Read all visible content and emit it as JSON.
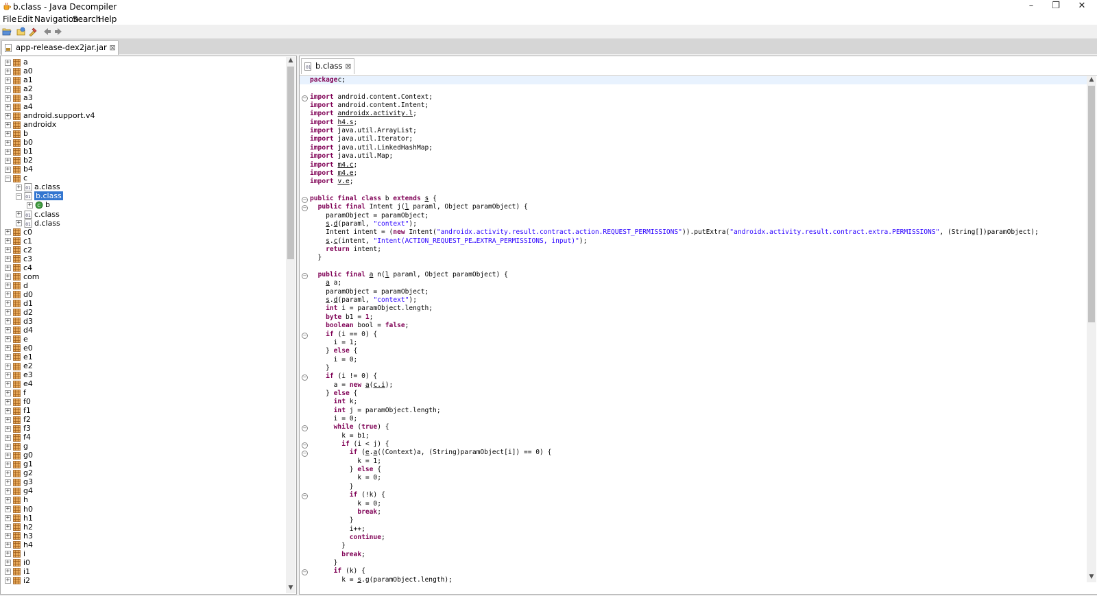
{
  "window": {
    "title": "b.class - Java Decompiler",
    "controls": [
      "–",
      "❐",
      "✕"
    ]
  },
  "menu": [
    "File",
    "Edit",
    "Navigation",
    "Search",
    "Help"
  ],
  "left_tab": {
    "label": "app-release-dex2jar.jar"
  },
  "tree": [
    {
      "label": "a",
      "level": 0,
      "type": "pkg",
      "toggle": "+"
    },
    {
      "label": "a0",
      "level": 0,
      "type": "pkg",
      "toggle": "+"
    },
    {
      "label": "a1",
      "level": 0,
      "type": "pkg",
      "toggle": "+"
    },
    {
      "label": "a2",
      "level": 0,
      "type": "pkg",
      "toggle": "+"
    },
    {
      "label": "a3",
      "level": 0,
      "type": "pkg",
      "toggle": "+"
    },
    {
      "label": "a4",
      "level": 0,
      "type": "pkg",
      "toggle": "+"
    },
    {
      "label": "android.support.v4",
      "level": 0,
      "type": "pkg",
      "toggle": "+"
    },
    {
      "label": "androidx",
      "level": 0,
      "type": "pkg",
      "toggle": "+"
    },
    {
      "label": "b",
      "level": 0,
      "type": "pkg",
      "toggle": "+"
    },
    {
      "label": "b0",
      "level": 0,
      "type": "pkg",
      "toggle": "+"
    },
    {
      "label": "b1",
      "level": 0,
      "type": "pkg",
      "toggle": "+"
    },
    {
      "label": "b2",
      "level": 0,
      "type": "pkg",
      "toggle": "+"
    },
    {
      "label": "b4",
      "level": 0,
      "type": "pkg",
      "toggle": "+"
    },
    {
      "label": "c",
      "level": 0,
      "type": "pkg",
      "toggle": "-"
    },
    {
      "label": "a.class",
      "level": 1,
      "type": "class",
      "toggle": "+"
    },
    {
      "label": "b.class",
      "level": 1,
      "type": "class",
      "toggle": "-",
      "selected": true
    },
    {
      "label": "b",
      "level": 2,
      "type": "inner",
      "toggle": "+"
    },
    {
      "label": "c.class",
      "level": 1,
      "type": "class",
      "toggle": "+"
    },
    {
      "label": "d.class",
      "level": 1,
      "type": "class",
      "toggle": "+"
    },
    {
      "label": "c0",
      "level": 0,
      "type": "pkg",
      "toggle": "+"
    },
    {
      "label": "c1",
      "level": 0,
      "type": "pkg",
      "toggle": "+"
    },
    {
      "label": "c2",
      "level": 0,
      "type": "pkg",
      "toggle": "+"
    },
    {
      "label": "c3",
      "level": 0,
      "type": "pkg",
      "toggle": "+"
    },
    {
      "label": "c4",
      "level": 0,
      "type": "pkg",
      "toggle": "+"
    },
    {
      "label": "com",
      "level": 0,
      "type": "pkg",
      "toggle": "+"
    },
    {
      "label": "d",
      "level": 0,
      "type": "pkg",
      "toggle": "+"
    },
    {
      "label": "d0",
      "level": 0,
      "type": "pkg",
      "toggle": "+"
    },
    {
      "label": "d1",
      "level": 0,
      "type": "pkg",
      "toggle": "+"
    },
    {
      "label": "d2",
      "level": 0,
      "type": "pkg",
      "toggle": "+"
    },
    {
      "label": "d3",
      "level": 0,
      "type": "pkg",
      "toggle": "+"
    },
    {
      "label": "d4",
      "level": 0,
      "type": "pkg",
      "toggle": "+"
    },
    {
      "label": "e",
      "level": 0,
      "type": "pkg",
      "toggle": "+"
    },
    {
      "label": "e0",
      "level": 0,
      "type": "pkg",
      "toggle": "+"
    },
    {
      "label": "e1",
      "level": 0,
      "type": "pkg",
      "toggle": "+"
    },
    {
      "label": "e2",
      "level": 0,
      "type": "pkg",
      "toggle": "+"
    },
    {
      "label": "e3",
      "level": 0,
      "type": "pkg",
      "toggle": "+"
    },
    {
      "label": "e4",
      "level": 0,
      "type": "pkg",
      "toggle": "+"
    },
    {
      "label": "f",
      "level": 0,
      "type": "pkg",
      "toggle": "+"
    },
    {
      "label": "f0",
      "level": 0,
      "type": "pkg",
      "toggle": "+"
    },
    {
      "label": "f1",
      "level": 0,
      "type": "pkg",
      "toggle": "+"
    },
    {
      "label": "f2",
      "level": 0,
      "type": "pkg",
      "toggle": "+"
    },
    {
      "label": "f3",
      "level": 0,
      "type": "pkg",
      "toggle": "+"
    },
    {
      "label": "f4",
      "level": 0,
      "type": "pkg",
      "toggle": "+"
    },
    {
      "label": "g",
      "level": 0,
      "type": "pkg",
      "toggle": "+"
    },
    {
      "label": "g0",
      "level": 0,
      "type": "pkg",
      "toggle": "+"
    },
    {
      "label": "g1",
      "level": 0,
      "type": "pkg",
      "toggle": "+"
    },
    {
      "label": "g2",
      "level": 0,
      "type": "pkg",
      "toggle": "+"
    },
    {
      "label": "g3",
      "level": 0,
      "type": "pkg",
      "toggle": "+"
    },
    {
      "label": "g4",
      "level": 0,
      "type": "pkg",
      "toggle": "+"
    },
    {
      "label": "h",
      "level": 0,
      "type": "pkg",
      "toggle": "+"
    },
    {
      "label": "h0",
      "level": 0,
      "type": "pkg",
      "toggle": "+"
    },
    {
      "label": "h1",
      "level": 0,
      "type": "pkg",
      "toggle": "+"
    },
    {
      "label": "h2",
      "level": 0,
      "type": "pkg",
      "toggle": "+"
    },
    {
      "label": "h3",
      "level": 0,
      "type": "pkg",
      "toggle": "+"
    },
    {
      "label": "h4",
      "level": 0,
      "type": "pkg",
      "toggle": "+"
    },
    {
      "label": "i",
      "level": 0,
      "type": "pkg",
      "toggle": "+"
    },
    {
      "label": "i0",
      "level": 0,
      "type": "pkg",
      "toggle": "+"
    },
    {
      "label": "i1",
      "level": 0,
      "type": "pkg",
      "toggle": "+"
    },
    {
      "label": "i2",
      "level": 0,
      "type": "pkg",
      "toggle": "+"
    }
  ],
  "code_tab": {
    "label": "b.class"
  },
  "code": [
    {
      "fold": false,
      "t": [
        [
          "k",
          "package"
        ],
        [
          "",
          "c;"
        ]
      ]
    },
    {
      "fold": false,
      "t": []
    },
    {
      "fold": true,
      "t": [
        [
          "k",
          "import"
        ],
        [
          "",
          " android.content.Context;"
        ]
      ]
    },
    {
      "fold": false,
      "t": [
        [
          "k",
          "import"
        ],
        [
          "",
          " android.content.Intent;"
        ]
      ]
    },
    {
      "fold": false,
      "t": [
        [
          "k",
          "import"
        ],
        [
          "",
          " "
        ],
        [
          "u",
          "androidx.activity.l"
        ],
        [
          "",
          ";"
        ]
      ]
    },
    {
      "fold": false,
      "t": [
        [
          "k",
          "import"
        ],
        [
          "",
          " "
        ],
        [
          "u",
          "h4.s"
        ],
        [
          "",
          ";"
        ]
      ]
    },
    {
      "fold": false,
      "t": [
        [
          "k",
          "import"
        ],
        [
          "",
          " java.util.ArrayList;"
        ]
      ]
    },
    {
      "fold": false,
      "t": [
        [
          "k",
          "import"
        ],
        [
          "",
          " java.util.Iterator;"
        ]
      ]
    },
    {
      "fold": false,
      "t": [
        [
          "k",
          "import"
        ],
        [
          "",
          " java.util.LinkedHashMap;"
        ]
      ]
    },
    {
      "fold": false,
      "t": [
        [
          "k",
          "import"
        ],
        [
          "",
          " java.util.Map;"
        ]
      ]
    },
    {
      "fold": false,
      "t": [
        [
          "k",
          "import"
        ],
        [
          "",
          " "
        ],
        [
          "u",
          "m4.c"
        ],
        [
          "",
          ";"
        ]
      ]
    },
    {
      "fold": false,
      "t": [
        [
          "k",
          "import"
        ],
        [
          "",
          " "
        ],
        [
          "u",
          "m4.e"
        ],
        [
          "",
          ";"
        ]
      ]
    },
    {
      "fold": false,
      "t": [
        [
          "k",
          "import"
        ],
        [
          "",
          " "
        ],
        [
          "u",
          "v.e"
        ],
        [
          "",
          ";"
        ]
      ]
    },
    {
      "fold": false,
      "t": []
    },
    {
      "fold": true,
      "t": [
        [
          "k",
          "public final class"
        ],
        [
          "",
          " b "
        ],
        [
          "k",
          "extends"
        ],
        [
          "",
          " "
        ],
        [
          "u",
          "s"
        ],
        [
          "",
          " {"
        ]
      ]
    },
    {
      "fold": true,
      "t": [
        [
          "",
          "  "
        ],
        [
          "k",
          "public final"
        ],
        [
          "",
          " Intent j("
        ],
        [
          "u",
          "l"
        ],
        [
          "",
          " paraml, Object paramObject) {"
        ]
      ]
    },
    {
      "fold": false,
      "t": [
        [
          "",
          "    paramObject = paramObject;"
        ]
      ]
    },
    {
      "fold": false,
      "t": [
        [
          "",
          "    "
        ],
        [
          "u",
          "s"
        ],
        [
          "",
          "."
        ],
        [
          "u",
          "d"
        ],
        [
          "",
          "(paraml, "
        ],
        [
          "s",
          "\"context\""
        ],
        [
          "",
          ");"
        ]
      ]
    },
    {
      "fold": false,
      "t": [
        [
          "",
          "    Intent intent = ("
        ],
        [
          "k",
          "new"
        ],
        [
          "",
          " Intent("
        ],
        [
          "s",
          "\"androidx.activity.result.contract.action.REQUEST_PERMISSIONS\""
        ],
        [
          "",
          ")).putExtra("
        ],
        [
          "s",
          "\"androidx.activity.result.contract.extra.PERMISSIONS\""
        ],
        [
          "",
          ", (String[])paramObject);"
        ]
      ]
    },
    {
      "fold": false,
      "t": [
        [
          "",
          "    "
        ],
        [
          "u",
          "s"
        ],
        [
          "",
          "."
        ],
        [
          "u",
          "c"
        ],
        [
          "",
          "(intent, "
        ],
        [
          "s",
          "\"Intent(ACTION_REQUEST_PE…EXTRA_PERMISSIONS, input)\""
        ],
        [
          "",
          ");"
        ]
      ]
    },
    {
      "fold": false,
      "t": [
        [
          "",
          "    "
        ],
        [
          "k",
          "return"
        ],
        [
          "",
          " intent;"
        ]
      ]
    },
    {
      "fold": false,
      "t": [
        [
          "",
          "  }"
        ]
      ]
    },
    {
      "fold": false,
      "t": []
    },
    {
      "fold": true,
      "t": [
        [
          "",
          "  "
        ],
        [
          "k",
          "public final"
        ],
        [
          "",
          " "
        ],
        [
          "u",
          "a"
        ],
        [
          "",
          " n("
        ],
        [
          "u",
          "l"
        ],
        [
          "",
          " paraml, Object paramObject) {"
        ]
      ]
    },
    {
      "fold": false,
      "t": [
        [
          "",
          "    "
        ],
        [
          "u",
          "a"
        ],
        [
          "",
          " a;"
        ]
      ]
    },
    {
      "fold": false,
      "t": [
        [
          "",
          "    paramObject = paramObject;"
        ]
      ]
    },
    {
      "fold": false,
      "t": [
        [
          "",
          "    "
        ],
        [
          "u",
          "s"
        ],
        [
          "",
          "."
        ],
        [
          "u",
          "d"
        ],
        [
          "",
          "(paraml, "
        ],
        [
          "s",
          "\"context\""
        ],
        [
          "",
          ");"
        ]
      ]
    },
    {
      "fold": false,
      "t": [
        [
          "",
          "    "
        ],
        [
          "k",
          "int"
        ],
        [
          "",
          " i = paramObject.length;"
        ]
      ]
    },
    {
      "fold": false,
      "t": [
        [
          "",
          "    "
        ],
        [
          "k",
          "byte"
        ],
        [
          "",
          " b1 = "
        ],
        [
          "k",
          "1"
        ],
        [
          "",
          ";"
        ]
      ]
    },
    {
      "fold": false,
      "t": [
        [
          "",
          "    "
        ],
        [
          "k",
          "boolean"
        ],
        [
          "",
          " bool = "
        ],
        [
          "k",
          "false"
        ],
        [
          "",
          ";"
        ]
      ]
    },
    {
      "fold": true,
      "t": [
        [
          "",
          "    "
        ],
        [
          "k",
          "if"
        ],
        [
          "",
          " (i == 0) {"
        ]
      ]
    },
    {
      "fold": false,
      "t": [
        [
          "",
          "      i = 1;"
        ]
      ]
    },
    {
      "fold": false,
      "t": [
        [
          "",
          "    } "
        ],
        [
          "k",
          "else"
        ],
        [
          "",
          " {"
        ]
      ]
    },
    {
      "fold": false,
      "t": [
        [
          "",
          "      i = 0;"
        ]
      ]
    },
    {
      "fold": false,
      "t": [
        [
          "",
          "    }"
        ]
      ]
    },
    {
      "fold": true,
      "t": [
        [
          "",
          "    "
        ],
        [
          "k",
          "if"
        ],
        [
          "",
          " (i != 0) {"
        ]
      ]
    },
    {
      "fold": false,
      "t": [
        [
          "",
          "      a = "
        ],
        [
          "k",
          "new"
        ],
        [
          "",
          " "
        ],
        [
          "u",
          "a"
        ],
        [
          "",
          "("
        ],
        [
          "u",
          "c.i"
        ],
        [
          "",
          ");"
        ]
      ]
    },
    {
      "fold": false,
      "t": [
        [
          "",
          "    } "
        ],
        [
          "k",
          "else"
        ],
        [
          "",
          " {"
        ]
      ]
    },
    {
      "fold": false,
      "t": [
        [
          "",
          "      "
        ],
        [
          "k",
          "int"
        ],
        [
          "",
          " k;"
        ]
      ]
    },
    {
      "fold": false,
      "t": [
        [
          "",
          "      "
        ],
        [
          "k",
          "int"
        ],
        [
          "",
          " j = paramObject.length;"
        ]
      ]
    },
    {
      "fold": false,
      "t": [
        [
          "",
          "      i = 0;"
        ]
      ]
    },
    {
      "fold": true,
      "t": [
        [
          "",
          "      "
        ],
        [
          "k",
          "while"
        ],
        [
          "",
          " ("
        ],
        [
          "k",
          "true"
        ],
        [
          "",
          ") {"
        ]
      ]
    },
    {
      "fold": false,
      "t": [
        [
          "",
          "        k = b1;"
        ]
      ]
    },
    {
      "fold": true,
      "t": [
        [
          "",
          "        "
        ],
        [
          "k",
          "if"
        ],
        [
          "",
          " (i < j) {"
        ]
      ]
    },
    {
      "fold": true,
      "t": [
        [
          "",
          "          "
        ],
        [
          "k",
          "if"
        ],
        [
          "",
          " ("
        ],
        [
          "u",
          "e"
        ],
        [
          "",
          "."
        ],
        [
          "u",
          "a"
        ],
        [
          "",
          "((Context)a, (String)paramObject[i]) == 0) {"
        ]
      ]
    },
    {
      "fold": false,
      "t": [
        [
          "",
          "            k = 1;"
        ]
      ]
    },
    {
      "fold": false,
      "t": [
        [
          "",
          "          } "
        ],
        [
          "k",
          "else"
        ],
        [
          "",
          " {"
        ]
      ]
    },
    {
      "fold": false,
      "t": [
        [
          "",
          "            k = 0;"
        ]
      ]
    },
    {
      "fold": false,
      "t": [
        [
          "",
          "          }"
        ]
      ]
    },
    {
      "fold": true,
      "t": [
        [
          "",
          "          "
        ],
        [
          "k",
          "if"
        ],
        [
          "",
          " (!k) {"
        ]
      ]
    },
    {
      "fold": false,
      "t": [
        [
          "",
          "            k = 0;"
        ]
      ]
    },
    {
      "fold": false,
      "t": [
        [
          "",
          "            "
        ],
        [
          "k",
          "break"
        ],
        [
          "",
          ";"
        ]
      ]
    },
    {
      "fold": false,
      "t": [
        [
          "",
          "          }"
        ]
      ]
    },
    {
      "fold": false,
      "t": [
        [
          "",
          "          i++;"
        ]
      ]
    },
    {
      "fold": false,
      "t": [
        [
          "",
          "          "
        ],
        [
          "k",
          "continue"
        ],
        [
          "",
          ";"
        ]
      ]
    },
    {
      "fold": false,
      "t": [
        [
          "",
          "        }"
        ]
      ]
    },
    {
      "fold": false,
      "t": [
        [
          "",
          "        "
        ],
        [
          "k",
          "break"
        ],
        [
          "",
          ";"
        ]
      ]
    },
    {
      "fold": false,
      "t": [
        [
          "",
          "      }"
        ]
      ]
    },
    {
      "fold": true,
      "t": [
        [
          "",
          "      "
        ],
        [
          "k",
          "if"
        ],
        [
          "",
          " (k) {"
        ]
      ]
    },
    {
      "fold": false,
      "t": [
        [
          "",
          "        k = "
        ],
        [
          "u",
          "s"
        ],
        [
          "",
          "."
        ],
        [
          "u",
          "g"
        ],
        [
          "",
          "(paramObject.length);"
        ]
      ]
    }
  ]
}
